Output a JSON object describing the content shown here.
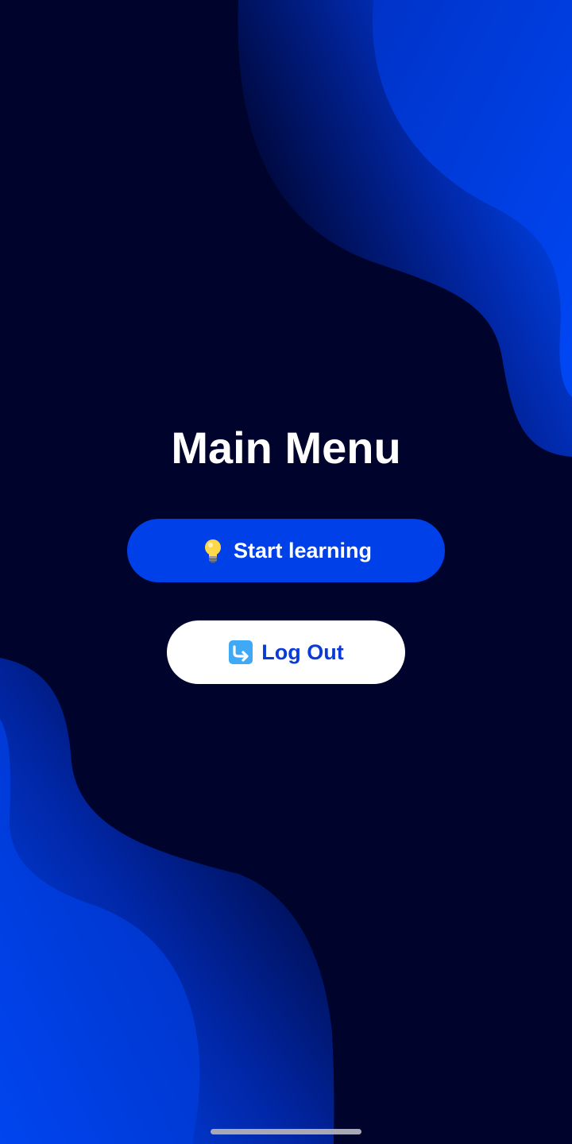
{
  "screen": {
    "title": "Main Menu"
  },
  "buttons": {
    "start_learning": {
      "label": "Start learning",
      "icon": "lightbulb-icon"
    },
    "log_out": {
      "label": "Log Out",
      "icon": "return-arrow-icon"
    }
  },
  "colors": {
    "background": "#00042c",
    "accent_blue": "#0040e8",
    "logout_text": "#0a3bd6",
    "white": "#ffffff"
  }
}
